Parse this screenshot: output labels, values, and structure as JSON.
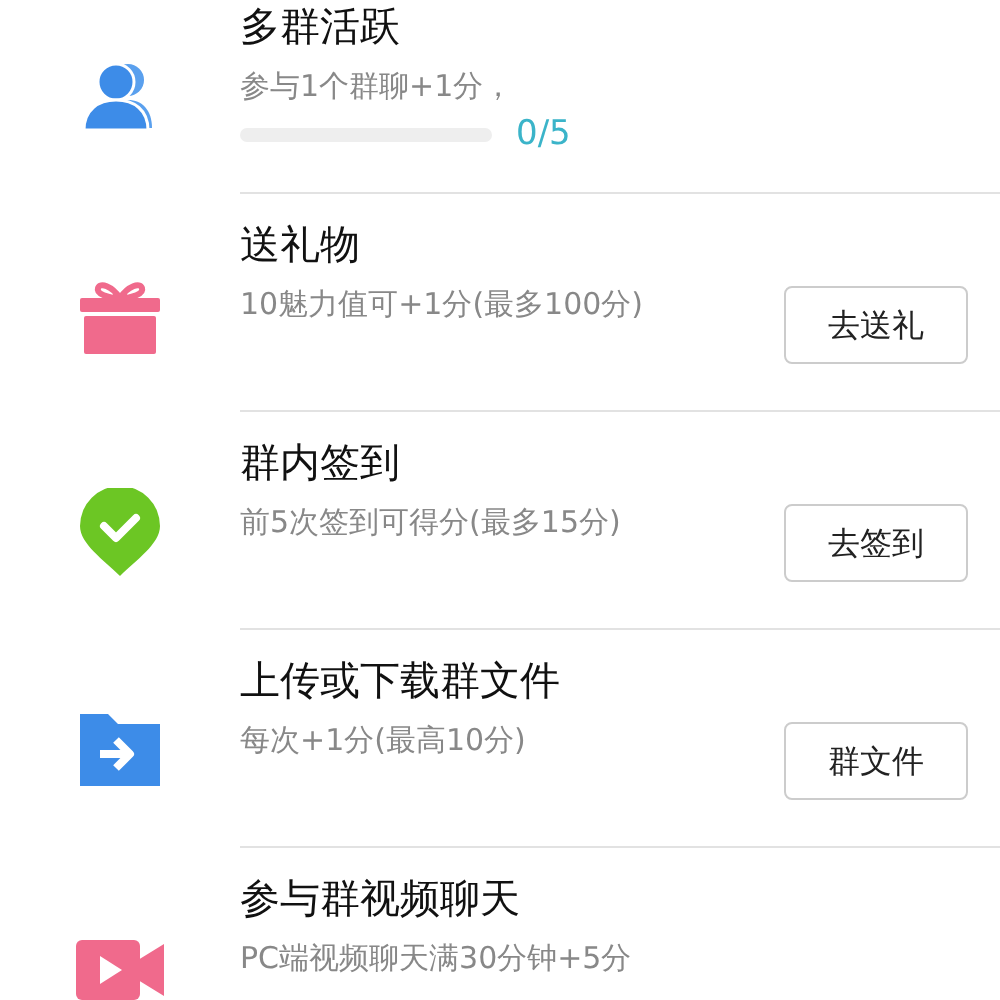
{
  "tasks": [
    {
      "kind": "people",
      "title": "多群活跃",
      "description": "参与1个群聊+1分，",
      "progress": {
        "level": 0,
        "reading": "0/5"
      }
    },
    {
      "kind": "gift",
      "title": "送礼物",
      "description": "10魅力值可+1分(最多100分)",
      "button": "去送礼"
    },
    {
      "kind": "pin",
      "title": "群内签到",
      "description": "前5次签到可得分(最多15分)",
      "button": "去签到"
    },
    {
      "kind": "folder",
      "title": "上传或下载群文件",
      "description": "每次+1分(最高10分)",
      "button": "群文件"
    },
    {
      "kind": "video",
      "title": "参与群视频聊天",
      "description": "PC端视频聊天满30分钟+5分"
    }
  ]
}
